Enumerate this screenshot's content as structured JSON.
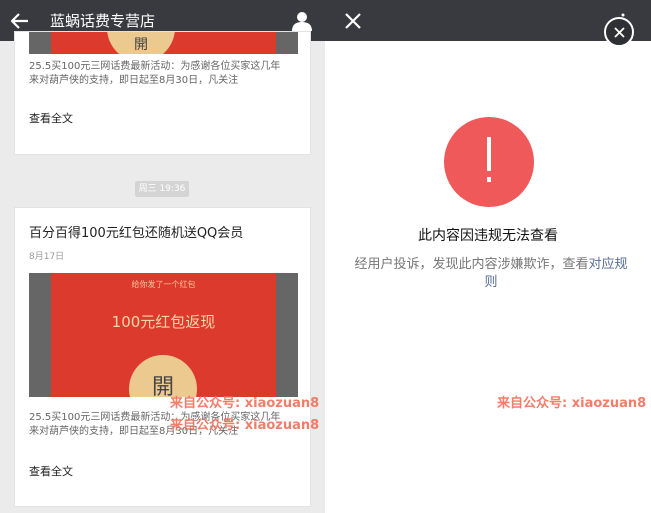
{
  "left": {
    "title": "蓝蜗话费专营店",
    "time_badge": "周三 19:36",
    "card_top": {
      "summary_1": "25.5买100元三网话费最新活动：为感谢各位买家这几年",
      "summary_2": "来对葫芦侠的支持，即日起至8月30日，凡关注",
      "read_all": "查看全文",
      "hb_char": "開"
    },
    "card_main": {
      "title": "百分百得100元红包还随机送QQ会员",
      "date": "8月17日",
      "hb_small": "给你发了一个红包",
      "hb_big": "100元红包返现",
      "hb_char": "開",
      "summary_1": "25.5买100元三网话费最新活动：为感谢各位买家这几年",
      "summary_2": "来对葫芦侠的支持，即日起至8月30日，凡关注",
      "read_all": "查看全文"
    }
  },
  "right": {
    "violate_title": "此内容因违规无法查看",
    "violate_desc": "经用户投诉，发现此内容涉嫌欺诈，查看",
    "violate_link": "对应规则"
  },
  "watermarks": {
    "w1": "来自公众号: xiaozuan8",
    "w2": "来自公众号: xiaozuan8",
    "w3": "来自公众号: xiaozuan8"
  },
  "colors": {
    "nav_bar": "#393a3f",
    "alert_red": "#f0595a",
    "link_blue": "#576b95",
    "hongbao_red": "#dd3a2e"
  },
  "icons": {
    "back": "back-arrow-icon",
    "person": "person-icon",
    "close": "close-icon",
    "more": "more-dots-icon",
    "alert": "exclamation-icon"
  }
}
